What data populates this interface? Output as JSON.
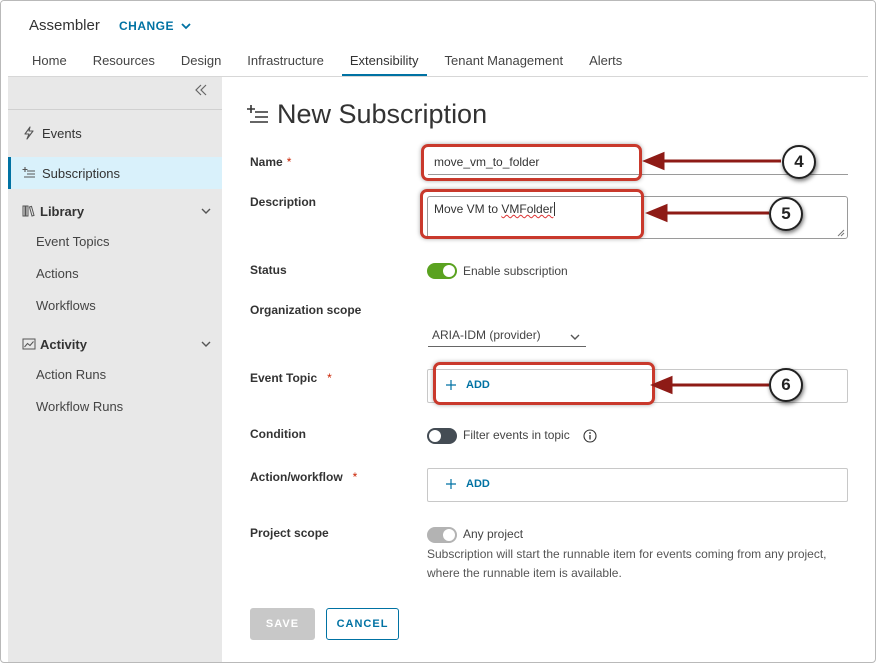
{
  "header": {
    "app_title": "Assembler",
    "change_label": "CHANGE",
    "tabs": [
      {
        "label": "Home",
        "active": false
      },
      {
        "label": "Resources",
        "active": false
      },
      {
        "label": "Design",
        "active": false
      },
      {
        "label": "Infrastructure",
        "active": false
      },
      {
        "label": "Extensibility",
        "active": true
      },
      {
        "label": "Tenant Management",
        "active": false
      },
      {
        "label": "Alerts",
        "active": false
      }
    ]
  },
  "sidebar": {
    "collapse_icon": "double-chevron-left-icon",
    "events": {
      "label": "Events",
      "icon": "lightning-icon"
    },
    "subscriptions": {
      "label": "Subscriptions",
      "icon": "plus-list-icon",
      "active": true
    },
    "library": {
      "label": "Library",
      "icon": "library-icon",
      "items": [
        "Event Topics",
        "Actions",
        "Workflows"
      ]
    },
    "activity": {
      "label": "Activity",
      "icon": "activity-chart-icon",
      "items": [
        "Action Runs",
        "Workflow Runs"
      ]
    }
  },
  "form": {
    "title": "New Subscription",
    "title_icon": "plus-list-icon",
    "required_mark": "*",
    "name_label": "Name",
    "name_value": "move_vm_to_folder",
    "description_label": "Description",
    "description_value_part1": "Move VM to ",
    "description_value_part2": "VMFolder",
    "status_label": "Status",
    "status_toggle_label": "Enable subscription",
    "status_enabled": true,
    "org_scope_label": "Organization scope",
    "org_scope_value": "ARIA-IDM (provider)",
    "event_topic_label": "Event Topic",
    "add_label": "ADD",
    "condition_label": "Condition",
    "condition_toggle_label": "Filter events in topic",
    "condition_enabled": false,
    "action_label": "Action/workflow",
    "project_scope_label": "Project scope",
    "project_toggle_label": "Any project",
    "project_help": "Subscription will start the runnable item for events coming from any project, where the runnable item is available.",
    "save_label": "SAVE",
    "cancel_label": "CANCEL"
  },
  "colors": {
    "accent": "#0072a3",
    "required": "#c92100",
    "toggle_on": "#5aa220",
    "toggle_off": "#444c54",
    "callout_red": "#c9392c",
    "arrow": "#8e1b16"
  },
  "callouts": [
    "4",
    "5",
    "6"
  ]
}
